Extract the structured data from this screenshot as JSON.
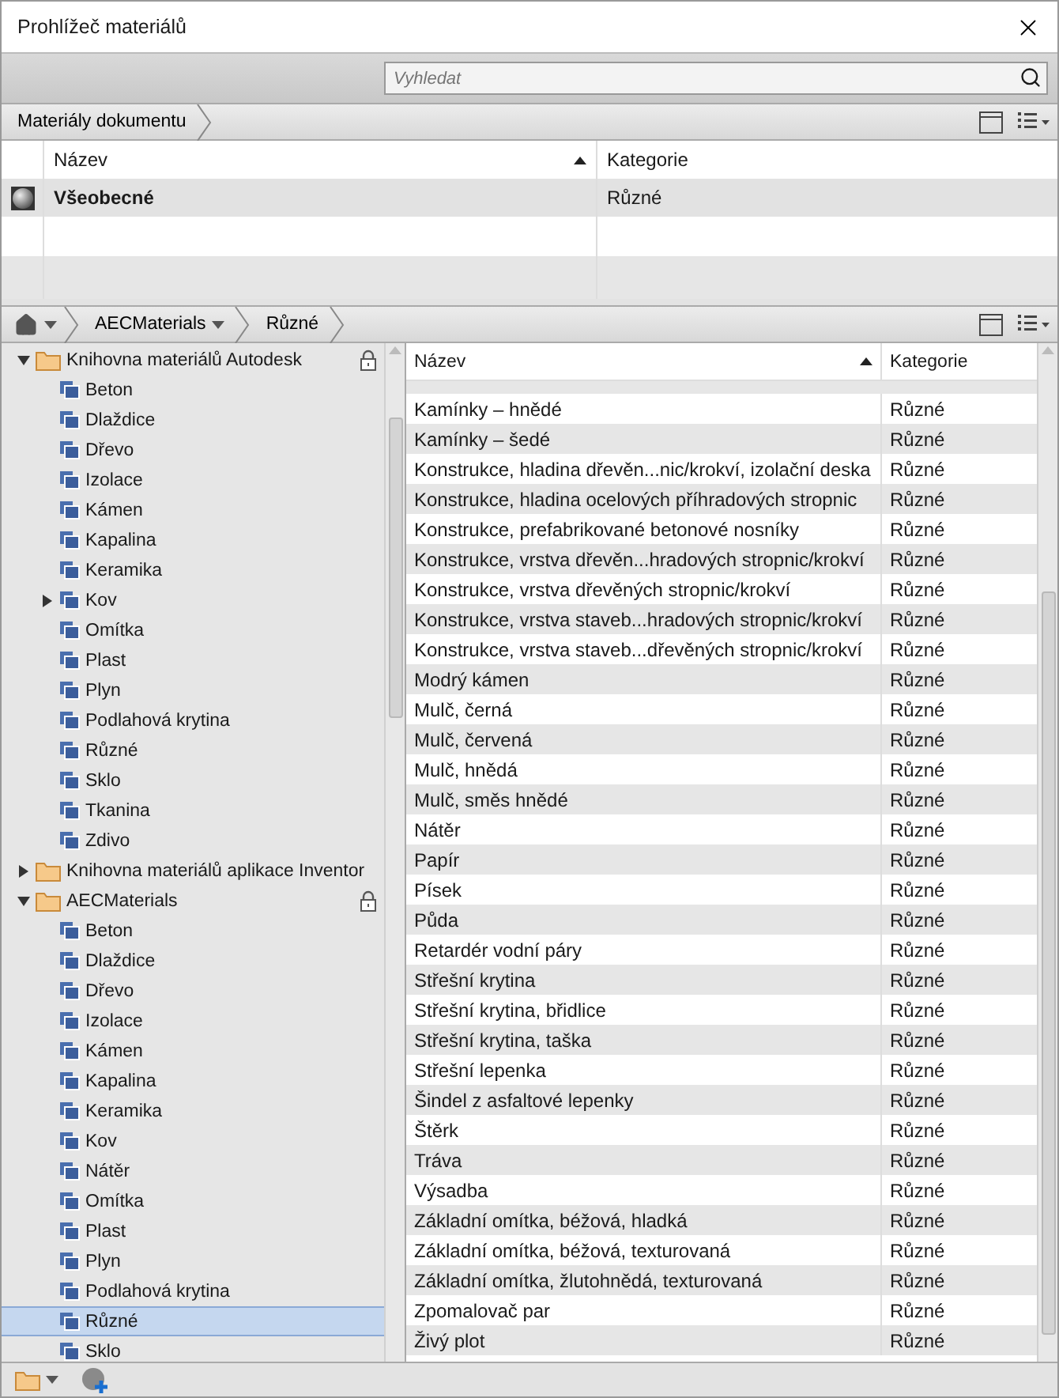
{
  "window": {
    "title": "Prohlížeč materiálů"
  },
  "search": {
    "placeholder": "Vyhledat"
  },
  "document_bar": {
    "breadcrumbs": [
      "Materiály dokumentu"
    ]
  },
  "document_table": {
    "columns": [
      {
        "label": "Název",
        "sorted": true
      },
      {
        "label": "Kategorie",
        "sorted": false
      }
    ],
    "rows": [
      {
        "name": "Všeobecné",
        "category": "Různé",
        "selected": true
      }
    ]
  },
  "library_bar": {
    "breadcrumbs": [
      {
        "label": "AECMaterials",
        "dropdown": true
      },
      {
        "label": "Různé",
        "dropdown": false
      }
    ]
  },
  "tree": [
    {
      "label": "Knihovna materiálů Autodesk",
      "expanded": true,
      "locked": true,
      "selected": false,
      "children": [
        {
          "label": "Beton",
          "selected": false
        },
        {
          "label": "Dlaždice",
          "selected": false
        },
        {
          "label": "Dřevo",
          "selected": false
        },
        {
          "label": "Izolace",
          "selected": false
        },
        {
          "label": "Kámen",
          "selected": false
        },
        {
          "label": "Kapalina",
          "selected": false
        },
        {
          "label": "Keramika",
          "selected": false
        },
        {
          "label": "Kov",
          "selected": false,
          "expanded": false
        },
        {
          "label": "Omítka",
          "selected": false
        },
        {
          "label": "Plast",
          "selected": false
        },
        {
          "label": "Plyn",
          "selected": false
        },
        {
          "label": "Podlahová krytina",
          "selected": false
        },
        {
          "label": "Různé",
          "selected": false
        },
        {
          "label": "Sklo",
          "selected": false
        },
        {
          "label": "Tkanina",
          "selected": false
        },
        {
          "label": "Zdivo",
          "selected": false
        }
      ]
    },
    {
      "label": "Knihovna materiálů aplikace Inventor",
      "expanded": false,
      "locked": false,
      "selected": false
    },
    {
      "label": "AECMaterials",
      "expanded": true,
      "locked": true,
      "selected": false,
      "children": [
        {
          "label": "Beton",
          "selected": false
        },
        {
          "label": "Dlaždice",
          "selected": false
        },
        {
          "label": "Dřevo",
          "selected": false
        },
        {
          "label": "Izolace",
          "selected": false
        },
        {
          "label": "Kámen",
          "selected": false
        },
        {
          "label": "Kapalina",
          "selected": false
        },
        {
          "label": "Keramika",
          "selected": false
        },
        {
          "label": "Kov",
          "selected": false
        },
        {
          "label": "Nátěr",
          "selected": false
        },
        {
          "label": "Omítka",
          "selected": false
        },
        {
          "label": "Plast",
          "selected": false
        },
        {
          "label": "Plyn",
          "selected": false
        },
        {
          "label": "Podlahová krytina",
          "selected": false
        },
        {
          "label": "Různé",
          "selected": true
        },
        {
          "label": "Sklo",
          "selected": false
        }
      ]
    }
  ],
  "materials_table": {
    "columns": [
      {
        "label": "Název",
        "sorted": true
      },
      {
        "label": "Kategorie",
        "sorted": false
      }
    ],
    "rows": [
      {
        "name": "Kamínky – hnědé",
        "category": "Různé"
      },
      {
        "name": "Kamínky – šedé",
        "category": "Různé"
      },
      {
        "name": "Konstrukce, hladina dřevěn...nic/krokví, izolační deska",
        "category": "Různé"
      },
      {
        "name": "Konstrukce, hladina ocelových příhradových stropnic",
        "category": "Různé"
      },
      {
        "name": "Konstrukce, prefabrikované betonové nosníky",
        "category": "Různé"
      },
      {
        "name": "Konstrukce, vrstva dřevěn...hradových stropnic/krokví",
        "category": "Různé"
      },
      {
        "name": "Konstrukce, vrstva dřevěných stropnic/krokví",
        "category": "Různé"
      },
      {
        "name": "Konstrukce, vrstva staveb...hradových stropnic/krokví",
        "category": "Různé"
      },
      {
        "name": "Konstrukce, vrstva staveb...dřevěných stropnic/krokví",
        "category": "Různé"
      },
      {
        "name": "Modrý kámen",
        "category": "Různé"
      },
      {
        "name": "Mulč, černá",
        "category": "Různé"
      },
      {
        "name": "Mulč, červená",
        "category": "Různé"
      },
      {
        "name": "Mulč, hnědá",
        "category": "Různé"
      },
      {
        "name": "Mulč, směs hnědé",
        "category": "Různé"
      },
      {
        "name": "Nátěr",
        "category": "Různé"
      },
      {
        "name": "Papír",
        "category": "Různé"
      },
      {
        "name": "Písek",
        "category": "Různé"
      },
      {
        "name": "Půda",
        "category": "Různé"
      },
      {
        "name": "Retardér vodní páry",
        "category": "Různé"
      },
      {
        "name": "Střešní krytina",
        "category": "Různé"
      },
      {
        "name": "Střešní krytina, břidlice",
        "category": "Různé"
      },
      {
        "name": "Střešní krytina, taška",
        "category": "Různé"
      },
      {
        "name": "Střešní lepenka",
        "category": "Různé"
      },
      {
        "name": "Šindel z asfaltové lepenky",
        "category": "Různé"
      },
      {
        "name": "Štěrk",
        "category": "Různé"
      },
      {
        "name": "Tráva",
        "category": "Různé"
      },
      {
        "name": "Výsadba",
        "category": "Různé"
      },
      {
        "name": "Základní omítka, béžová, hladká",
        "category": "Různé"
      },
      {
        "name": "Základní omítka, béžová, texturovaná",
        "category": "Různé"
      },
      {
        "name": "Základní omítka, žlutohnědá, texturovaná",
        "category": "Různé"
      },
      {
        "name": "Zpomalovač par",
        "category": "Různé"
      },
      {
        "name": "Živý plot",
        "category": "Různé"
      }
    ]
  }
}
